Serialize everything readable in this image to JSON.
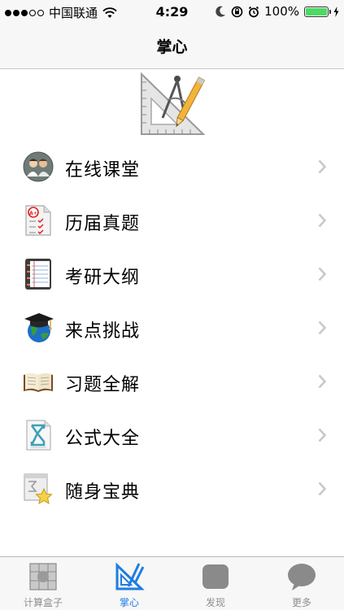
{
  "status_bar": {
    "carrier": "中国联通",
    "time": "4:29",
    "battery": "100%"
  },
  "nav": {
    "title": "掌心"
  },
  "menu": {
    "items": [
      {
        "label": "在线课堂",
        "icon": "classroom-icon"
      },
      {
        "label": "历届真题",
        "icon": "exam-paper-icon"
      },
      {
        "label": "考研大纲",
        "icon": "notebook-icon"
      },
      {
        "label": "来点挑战",
        "icon": "graduation-globe-icon"
      },
      {
        "label": "习题全解",
        "icon": "open-book-icon"
      },
      {
        "label": "公式大全",
        "icon": "sigma-formula-icon"
      },
      {
        "label": "随身宝典",
        "icon": "star-document-icon"
      }
    ]
  },
  "tabs": [
    {
      "label": "计算盒子",
      "icon": "calculator-box-icon",
      "active": false
    },
    {
      "label": "掌心",
      "icon": "ruler-compass-icon",
      "active": true
    },
    {
      "label": "发现",
      "icon": "discover-icon",
      "active": false
    },
    {
      "label": "更多",
      "icon": "chat-bubble-icon",
      "active": false
    }
  ],
  "colors": {
    "accent": "#1e7de2",
    "tab_inactive": "#8e8e8e",
    "battery": "#4cd964",
    "bar_background": "#f7f7f7"
  }
}
